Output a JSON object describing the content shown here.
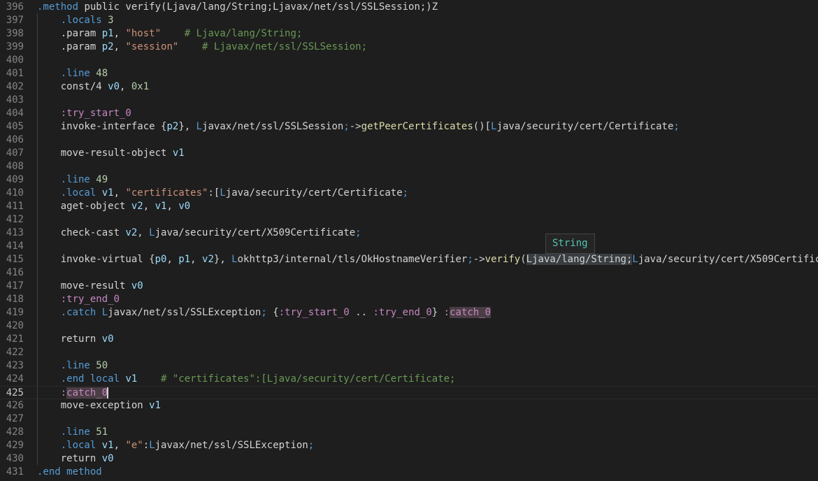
{
  "lines": [
    {
      "n": "396",
      "tokens": [
        [
          ".method ",
          "dir"
        ],
        [
          "public verify",
          "kw"
        ],
        [
          "(Ljava/lang/String;Ljavax/net/ssl/SSLSession;)Z",
          "kw"
        ]
      ]
    },
    {
      "n": "397",
      "tokens": [
        [
          "    ",
          "pl"
        ],
        [
          ".locals ",
          "dir"
        ],
        [
          "3",
          "num"
        ]
      ]
    },
    {
      "n": "398",
      "tokens": [
        [
          "    ",
          "pl"
        ],
        [
          ".param ",
          "pl"
        ],
        [
          "p1",
          "reg"
        ],
        [
          ", ",
          "pl"
        ],
        [
          "\"host\"",
          "str"
        ],
        [
          "    # Ljava/lang/String;",
          "cmt"
        ]
      ]
    },
    {
      "n": "399",
      "tokens": [
        [
          "    ",
          "pl"
        ],
        [
          ".param ",
          "pl"
        ],
        [
          "p2",
          "reg"
        ],
        [
          ", ",
          "pl"
        ],
        [
          "\"session\"",
          "str"
        ],
        [
          "    # Ljavax/net/ssl/SSLSession;",
          "cmt"
        ]
      ]
    },
    {
      "n": "400",
      "tokens": []
    },
    {
      "n": "401",
      "tokens": [
        [
          "    ",
          "pl"
        ],
        [
          ".line ",
          "dir"
        ],
        [
          "48",
          "num"
        ]
      ]
    },
    {
      "n": "402",
      "tokens": [
        [
          "    ",
          "pl"
        ],
        [
          "const/4 ",
          "pl"
        ],
        [
          "v0",
          "reg"
        ],
        [
          ", ",
          "pl"
        ],
        [
          "0x1",
          "num"
        ]
      ]
    },
    {
      "n": "403",
      "tokens": []
    },
    {
      "n": "404",
      "tokens": [
        [
          "    ",
          "pl"
        ],
        [
          ":try_start_0",
          "lbl"
        ]
      ]
    },
    {
      "n": "405",
      "tokens": [
        [
          "    ",
          "pl"
        ],
        [
          "invoke-interface ",
          "pl"
        ],
        [
          "{",
          "pl"
        ],
        [
          "p2",
          "reg"
        ],
        [
          "}, ",
          "pl"
        ],
        [
          "L",
          "L"
        ],
        [
          "javax/net/ssl/SSLSession",
          "pl"
        ],
        [
          ";",
          "semi"
        ],
        [
          "->",
          "pl"
        ],
        [
          "getPeerCertificates",
          "fn"
        ],
        [
          "()[",
          "pl"
        ],
        [
          "L",
          "L"
        ],
        [
          "java/security/cert/Certificate",
          "pl"
        ],
        [
          ";",
          "semi"
        ]
      ]
    },
    {
      "n": "406",
      "tokens": []
    },
    {
      "n": "407",
      "tokens": [
        [
          "    ",
          "pl"
        ],
        [
          "move-result-object ",
          "pl"
        ],
        [
          "v1",
          "reg"
        ]
      ]
    },
    {
      "n": "408",
      "tokens": []
    },
    {
      "n": "409",
      "tokens": [
        [
          "    ",
          "pl"
        ],
        [
          ".line ",
          "dir"
        ],
        [
          "49",
          "num"
        ]
      ]
    },
    {
      "n": "410",
      "tokens": [
        [
          "    ",
          "pl"
        ],
        [
          ".local ",
          "dir"
        ],
        [
          "v1",
          "reg"
        ],
        [
          ", ",
          "pl"
        ],
        [
          "\"certificates\"",
          "str"
        ],
        [
          ":[",
          "pl"
        ],
        [
          "L",
          "L"
        ],
        [
          "java/security/cert/Certificate",
          "pl"
        ],
        [
          ";",
          "semi"
        ]
      ]
    },
    {
      "n": "411",
      "tokens": [
        [
          "    ",
          "pl"
        ],
        [
          "aget-object ",
          "pl"
        ],
        [
          "v2",
          "reg"
        ],
        [
          ", ",
          "pl"
        ],
        [
          "v1",
          "reg"
        ],
        [
          ", ",
          "pl"
        ],
        [
          "v0",
          "reg"
        ]
      ]
    },
    {
      "n": "412",
      "tokens": []
    },
    {
      "n": "413",
      "tokens": [
        [
          "    ",
          "pl"
        ],
        [
          "check-cast ",
          "pl"
        ],
        [
          "v2",
          "reg"
        ],
        [
          ", ",
          "pl"
        ],
        [
          "L",
          "L"
        ],
        [
          "java/security/cert/X509Certificate",
          "pl"
        ],
        [
          ";",
          "semi"
        ]
      ]
    },
    {
      "n": "414",
      "tokens": []
    },
    {
      "n": "415",
      "tokens": [
        [
          "    ",
          "pl"
        ],
        [
          "invoke-virtual ",
          "pl"
        ],
        [
          "{",
          "pl"
        ],
        [
          "p0",
          "reg"
        ],
        [
          ", ",
          "pl"
        ],
        [
          "p1",
          "reg"
        ],
        [
          ", ",
          "pl"
        ],
        [
          "v2",
          "reg"
        ],
        [
          "}, ",
          "pl"
        ],
        [
          "L",
          "L"
        ],
        [
          "okhttp3/internal/tls/OkHostnameVerifier",
          "pl"
        ],
        [
          ";",
          "semi"
        ],
        [
          "->",
          "pl"
        ],
        [
          "verify",
          "fn"
        ],
        [
          "(",
          "pl"
        ],
        [
          "Ljava/lang/String;",
          "word"
        ],
        [
          "L",
          "L"
        ],
        [
          "java/security/cert/X509Certific",
          "pl"
        ]
      ]
    },
    {
      "n": "416",
      "tokens": []
    },
    {
      "n": "417",
      "tokens": [
        [
          "    ",
          "pl"
        ],
        [
          "move-result ",
          "pl"
        ],
        [
          "v0",
          "reg"
        ]
      ]
    },
    {
      "n": "418",
      "tokens": [
        [
          "    ",
          "pl"
        ],
        [
          ":try_end_0",
          "lbl"
        ]
      ]
    },
    {
      "n": "419",
      "tokens": [
        [
          "    ",
          "pl"
        ],
        [
          ".catch ",
          "dir"
        ],
        [
          "L",
          "L"
        ],
        [
          "javax/net/ssl/SSLException",
          "pl"
        ],
        [
          ";",
          "semi"
        ],
        [
          " {",
          "pl"
        ],
        [
          ":try_start_0",
          "lbl"
        ],
        [
          " .. ",
          "pl"
        ],
        [
          ":try_end_0",
          "lbl"
        ],
        [
          "} ",
          "pl"
        ],
        [
          ":",
          "lbl"
        ],
        [
          "catch_0",
          "box"
        ]
      ]
    },
    {
      "n": "420",
      "tokens": []
    },
    {
      "n": "421",
      "tokens": [
        [
          "    ",
          "pl"
        ],
        [
          "return ",
          "pl"
        ],
        [
          "v0",
          "reg"
        ]
      ]
    },
    {
      "n": "422",
      "tokens": []
    },
    {
      "n": "423",
      "tokens": [
        [
          "    ",
          "pl"
        ],
        [
          ".line ",
          "dir"
        ],
        [
          "50",
          "num"
        ]
      ]
    },
    {
      "n": "424",
      "tokens": [
        [
          "    ",
          "pl"
        ],
        [
          ".end local ",
          "dir"
        ],
        [
          "v1",
          "reg"
        ],
        [
          "    # \"certificates\":[Ljava/security/cert/Certificate;",
          "cmt"
        ]
      ]
    },
    {
      "n": "425",
      "tokens": [
        [
          "    ",
          "pl"
        ],
        [
          ":",
          "lbl"
        ],
        [
          "catch_0",
          "boxc"
        ]
      ],
      "current": true
    },
    {
      "n": "426",
      "tokens": [
        [
          "    ",
          "pl"
        ],
        [
          "move-exception ",
          "pl"
        ],
        [
          "v1",
          "reg"
        ]
      ]
    },
    {
      "n": "427",
      "tokens": []
    },
    {
      "n": "428",
      "tokens": [
        [
          "    ",
          "pl"
        ],
        [
          ".line ",
          "dir"
        ],
        [
          "51",
          "num"
        ]
      ]
    },
    {
      "n": "429",
      "tokens": [
        [
          "    ",
          "pl"
        ],
        [
          ".local ",
          "dir"
        ],
        [
          "v1",
          "reg"
        ],
        [
          ", ",
          "pl"
        ],
        [
          "\"e\"",
          "str"
        ],
        [
          ":",
          "pl"
        ],
        [
          "L",
          "L"
        ],
        [
          "javax/net/ssl/SSLException",
          "pl"
        ],
        [
          ";",
          "semi"
        ]
      ]
    },
    {
      "n": "430",
      "tokens": [
        [
          "    ",
          "pl"
        ],
        [
          "return ",
          "pl"
        ],
        [
          "v0",
          "reg"
        ]
      ]
    },
    {
      "n": "431",
      "tokens": [
        [
          ".end method",
          "dir"
        ]
      ]
    }
  ],
  "tooltip": {
    "text": "String"
  }
}
